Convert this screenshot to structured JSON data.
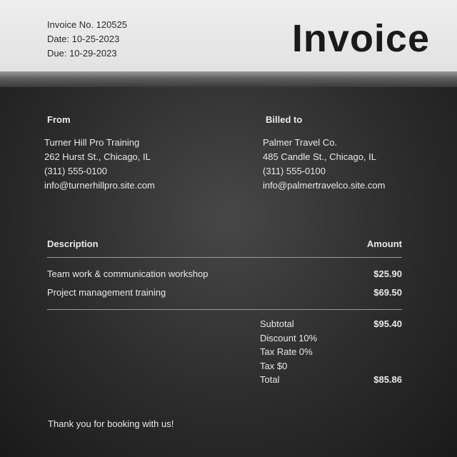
{
  "header": {
    "invoice_no": "Invoice No. 120525",
    "date": "Date: 10-25-2023",
    "due": "Due: 10-29-2023",
    "title": "Invoice"
  },
  "from": {
    "heading": "From",
    "name": "Turner Hill Pro Training",
    "address": "262 Hurst St., Chicago, IL",
    "phone": "(311) 555-0100",
    "email": "info@turnerhillpro.site.com"
  },
  "billed_to": {
    "heading": "Billed to",
    "name": "Palmer Travel Co.",
    "address": "485 Candle St., Chicago, IL",
    "phone": "(311) 555-0100",
    "email": "info@palmertravelco.site.com"
  },
  "table": {
    "col_description": "Description",
    "col_amount": "Amount",
    "items": [
      {
        "description": "Team work & communication workshop",
        "amount": "$25.90"
      },
      {
        "description": "Project management training",
        "amount": "$69.50"
      }
    ]
  },
  "totals": {
    "subtotal_label": "Subtotal",
    "subtotal_value": "$95.40",
    "discount_label": "Discount 10%",
    "tax_rate_label": "Tax Rate 0%",
    "tax_label": "Tax $0",
    "total_label": "Total",
    "total_value": "$85.86"
  },
  "footer": {
    "thanks": "Thank you for booking with us!"
  },
  "colors": {
    "header_bg": "#eeeeee",
    "body_bg": "#2c2c2c",
    "text_light": "#e9e9e9",
    "text_dark": "#1a1a1a"
  }
}
